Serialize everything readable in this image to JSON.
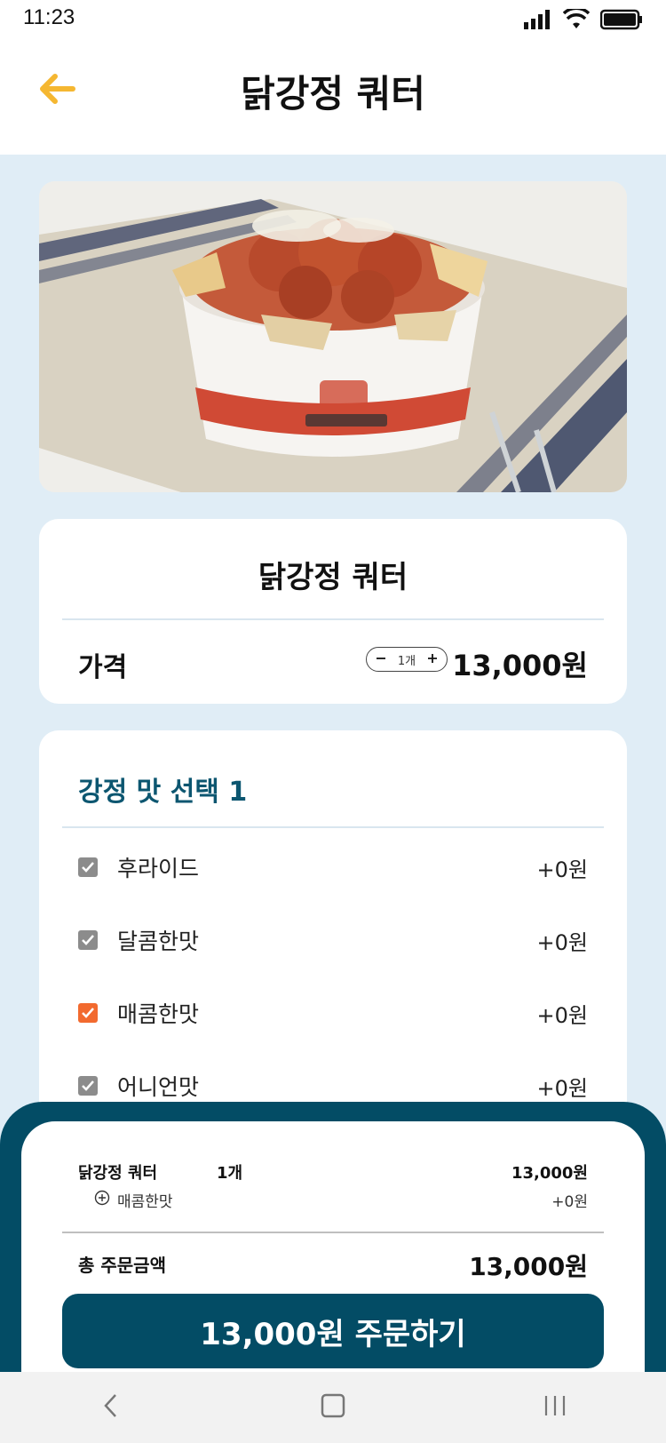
{
  "status_bar": {
    "time": "11:23"
  },
  "header": {
    "title": "닭강정 쿼터"
  },
  "product": {
    "name": "닭강정 쿼터",
    "price_label": "가격",
    "quantity": "1개",
    "price": "13,000원"
  },
  "options": {
    "title": "강정 맛 선택 1",
    "items": [
      {
        "label": "후라이드",
        "price": "+0원",
        "checked": false
      },
      {
        "label": "달콤한맛",
        "price": "+0원",
        "checked": false
      },
      {
        "label": "매콤한맛",
        "price": "+0원",
        "checked": true
      },
      {
        "label": "어니언맛",
        "price": "+0원",
        "checked": false
      }
    ]
  },
  "summary": {
    "item_name": "닭강정 쿼터",
    "item_qty": "1개",
    "item_price": "13,000원",
    "option_name": "매콤한맛",
    "option_price": "+0원",
    "total_label": "총 주문금액",
    "total_value": "13,000원",
    "order_button": "13,000원 주문하기"
  },
  "colors": {
    "accent": "#f5b731",
    "brand": "#034c65",
    "checked": "#f26a2f",
    "unchecked": "#8c8c8c"
  }
}
